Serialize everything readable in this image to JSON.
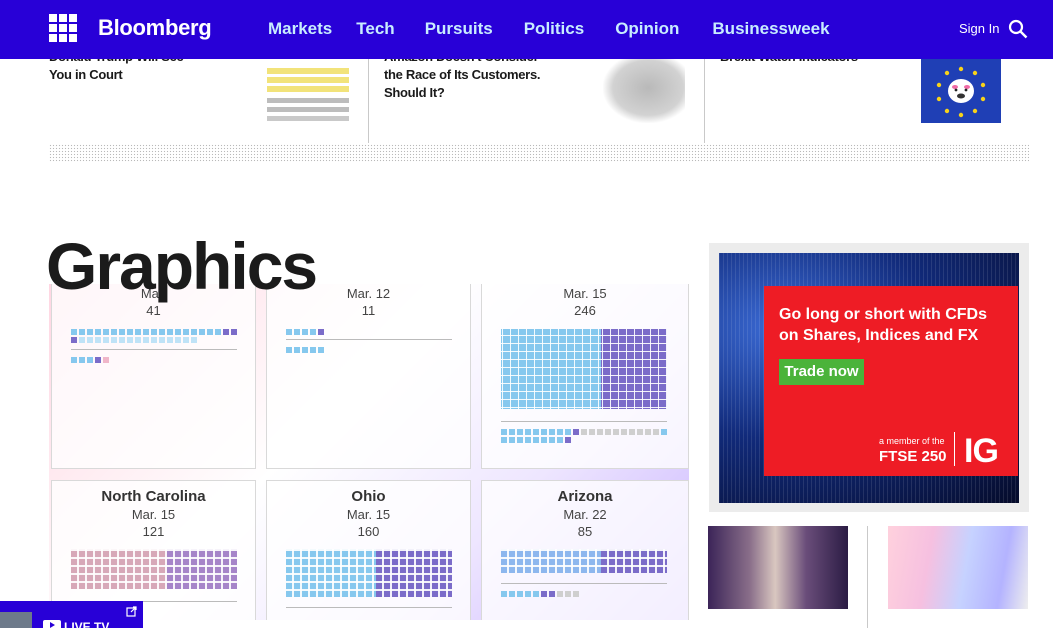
{
  "nav": {
    "logo": "Bloomberg",
    "items": [
      "Markets",
      "Tech",
      "Pursuits",
      "Politics",
      "Opinion",
      "Businessweek"
    ],
    "signin": "Sign In"
  },
  "stories": [
    {
      "title": "Donald Trump Will See You in Court"
    },
    {
      "title": "Amazon Doesn't Consider the Race of Its Customers. Should It?"
    },
    {
      "title": "Brexit Watch Indicators"
    }
  ],
  "section": {
    "heading": "Graphics"
  },
  "graphic": {
    "states": [
      {
        "name": "",
        "date": "Mar.",
        "count": "41"
      },
      {
        "name": "",
        "date": "Mar. 12",
        "count": "11"
      },
      {
        "name": "",
        "date": "Mar. 15",
        "count": "246"
      },
      {
        "name": "North Carolina",
        "date": "Mar. 15",
        "count": "121"
      },
      {
        "name": "Ohio",
        "date": "Mar. 15",
        "count": "160"
      },
      {
        "name": "Arizona",
        "date": "Mar. 22",
        "count": "85"
      }
    ]
  },
  "ad": {
    "headline": "Go long or short with CFDs on Shares, Indices and FX",
    "cta": "Trade now",
    "member": "a member of the",
    "ftse": "FTSE 250",
    "brand": "IG"
  },
  "livetv": {
    "label": "LIVE TV"
  },
  "colors": {
    "brand": "#2800d7",
    "nav_text": "#c8ecff",
    "ad_red": "#ee1c25",
    "ad_green": "#4bb33a"
  }
}
